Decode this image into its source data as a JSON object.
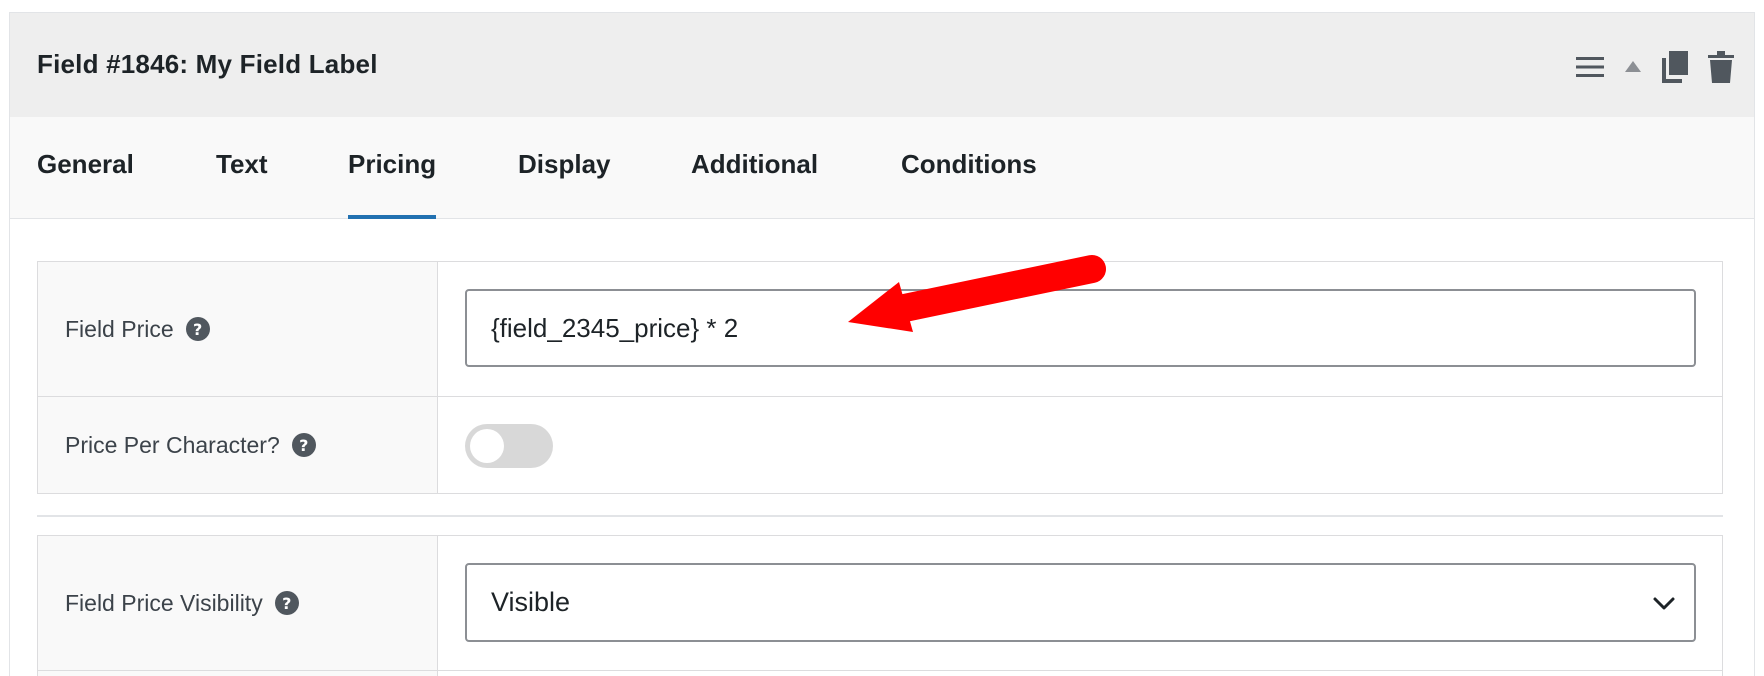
{
  "field": {
    "title": "Field #1846: My Field Label"
  },
  "header_actions": [
    {
      "icon": "menu-icon",
      "label": "Menu"
    },
    {
      "icon": "collapse-triangle-icon",
      "label": "Collapse"
    },
    {
      "icon": "duplicate-icon",
      "label": "Duplicate"
    },
    {
      "icon": "trash-icon",
      "label": "Delete"
    }
  ],
  "tabs": [
    {
      "label": "General",
      "active": false
    },
    {
      "label": "Text",
      "active": false
    },
    {
      "label": "Pricing",
      "active": true
    },
    {
      "label": "Display",
      "active": false
    },
    {
      "label": "Additional",
      "active": false
    },
    {
      "label": "Conditions",
      "active": false
    }
  ],
  "pricing": {
    "field_price": {
      "label": "Field Price",
      "value": "{field_2345_price} * 2"
    },
    "price_per_character": {
      "label": "Price Per Character?",
      "enabled": false
    },
    "visibility": {
      "label": "Field Price Visibility",
      "selected": "Visible"
    }
  },
  "colors": {
    "accent": "#2271b1",
    "annotation_arrow": "#ff0000",
    "header_bg": "#eeeeee",
    "tabs_bg": "#f9f9f9"
  },
  "help_glyph": "?"
}
